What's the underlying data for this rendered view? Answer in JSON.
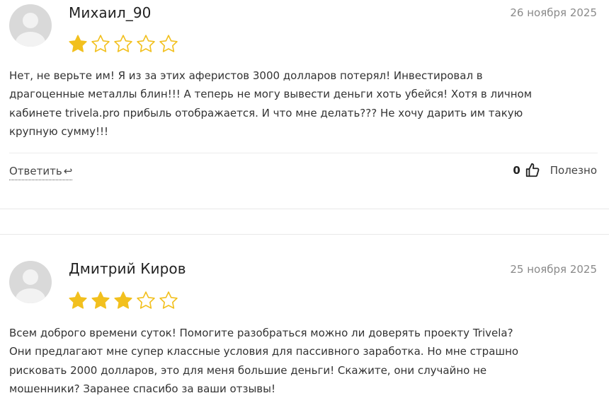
{
  "reviews": [
    {
      "author": "Михаил_90",
      "date": "26 ноября 2025",
      "rating": 1,
      "max_rating": 5,
      "text_lines": [
        "Нет, не верьте им! Я из за этих аферистов 3000 долларов потерял! Инвестировал в",
        "драгоценные металлы блин!!! А теперь не могу вывести деньги хоть убейся! Хотя в личном",
        "кабинете trivela.pro прибыль отображается. И что мне делать??? Не хочу дарить им такую",
        "крупную сумму!!!"
      ],
      "reply_label": "Ответить",
      "reply_icon": "↩",
      "useful_count": "0",
      "useful_label": "Полезно"
    },
    {
      "author": "Дмитрий Киров",
      "date": "25 ноября 2025",
      "rating": 3,
      "max_rating": 5,
      "text_lines": [
        "Всем доброго времени суток! Помогите разобраться можно ли доверять проекту Trivela?",
        "Они предлагают мне супер классные условия для пассивного заработка. Но мне страшно",
        "рисковать 2000 долларов, это для меня большие деньги! Скажите, они случайно не",
        "мошенники? Заранее спасибо за ваши отзывы!"
      ]
    }
  ],
  "colors": {
    "star_filled": "#F2C01E",
    "star_empty_stroke": "#F2C01E",
    "avatar_bg": "#D9D9D9",
    "avatar_fg": "#F5F5F5"
  }
}
